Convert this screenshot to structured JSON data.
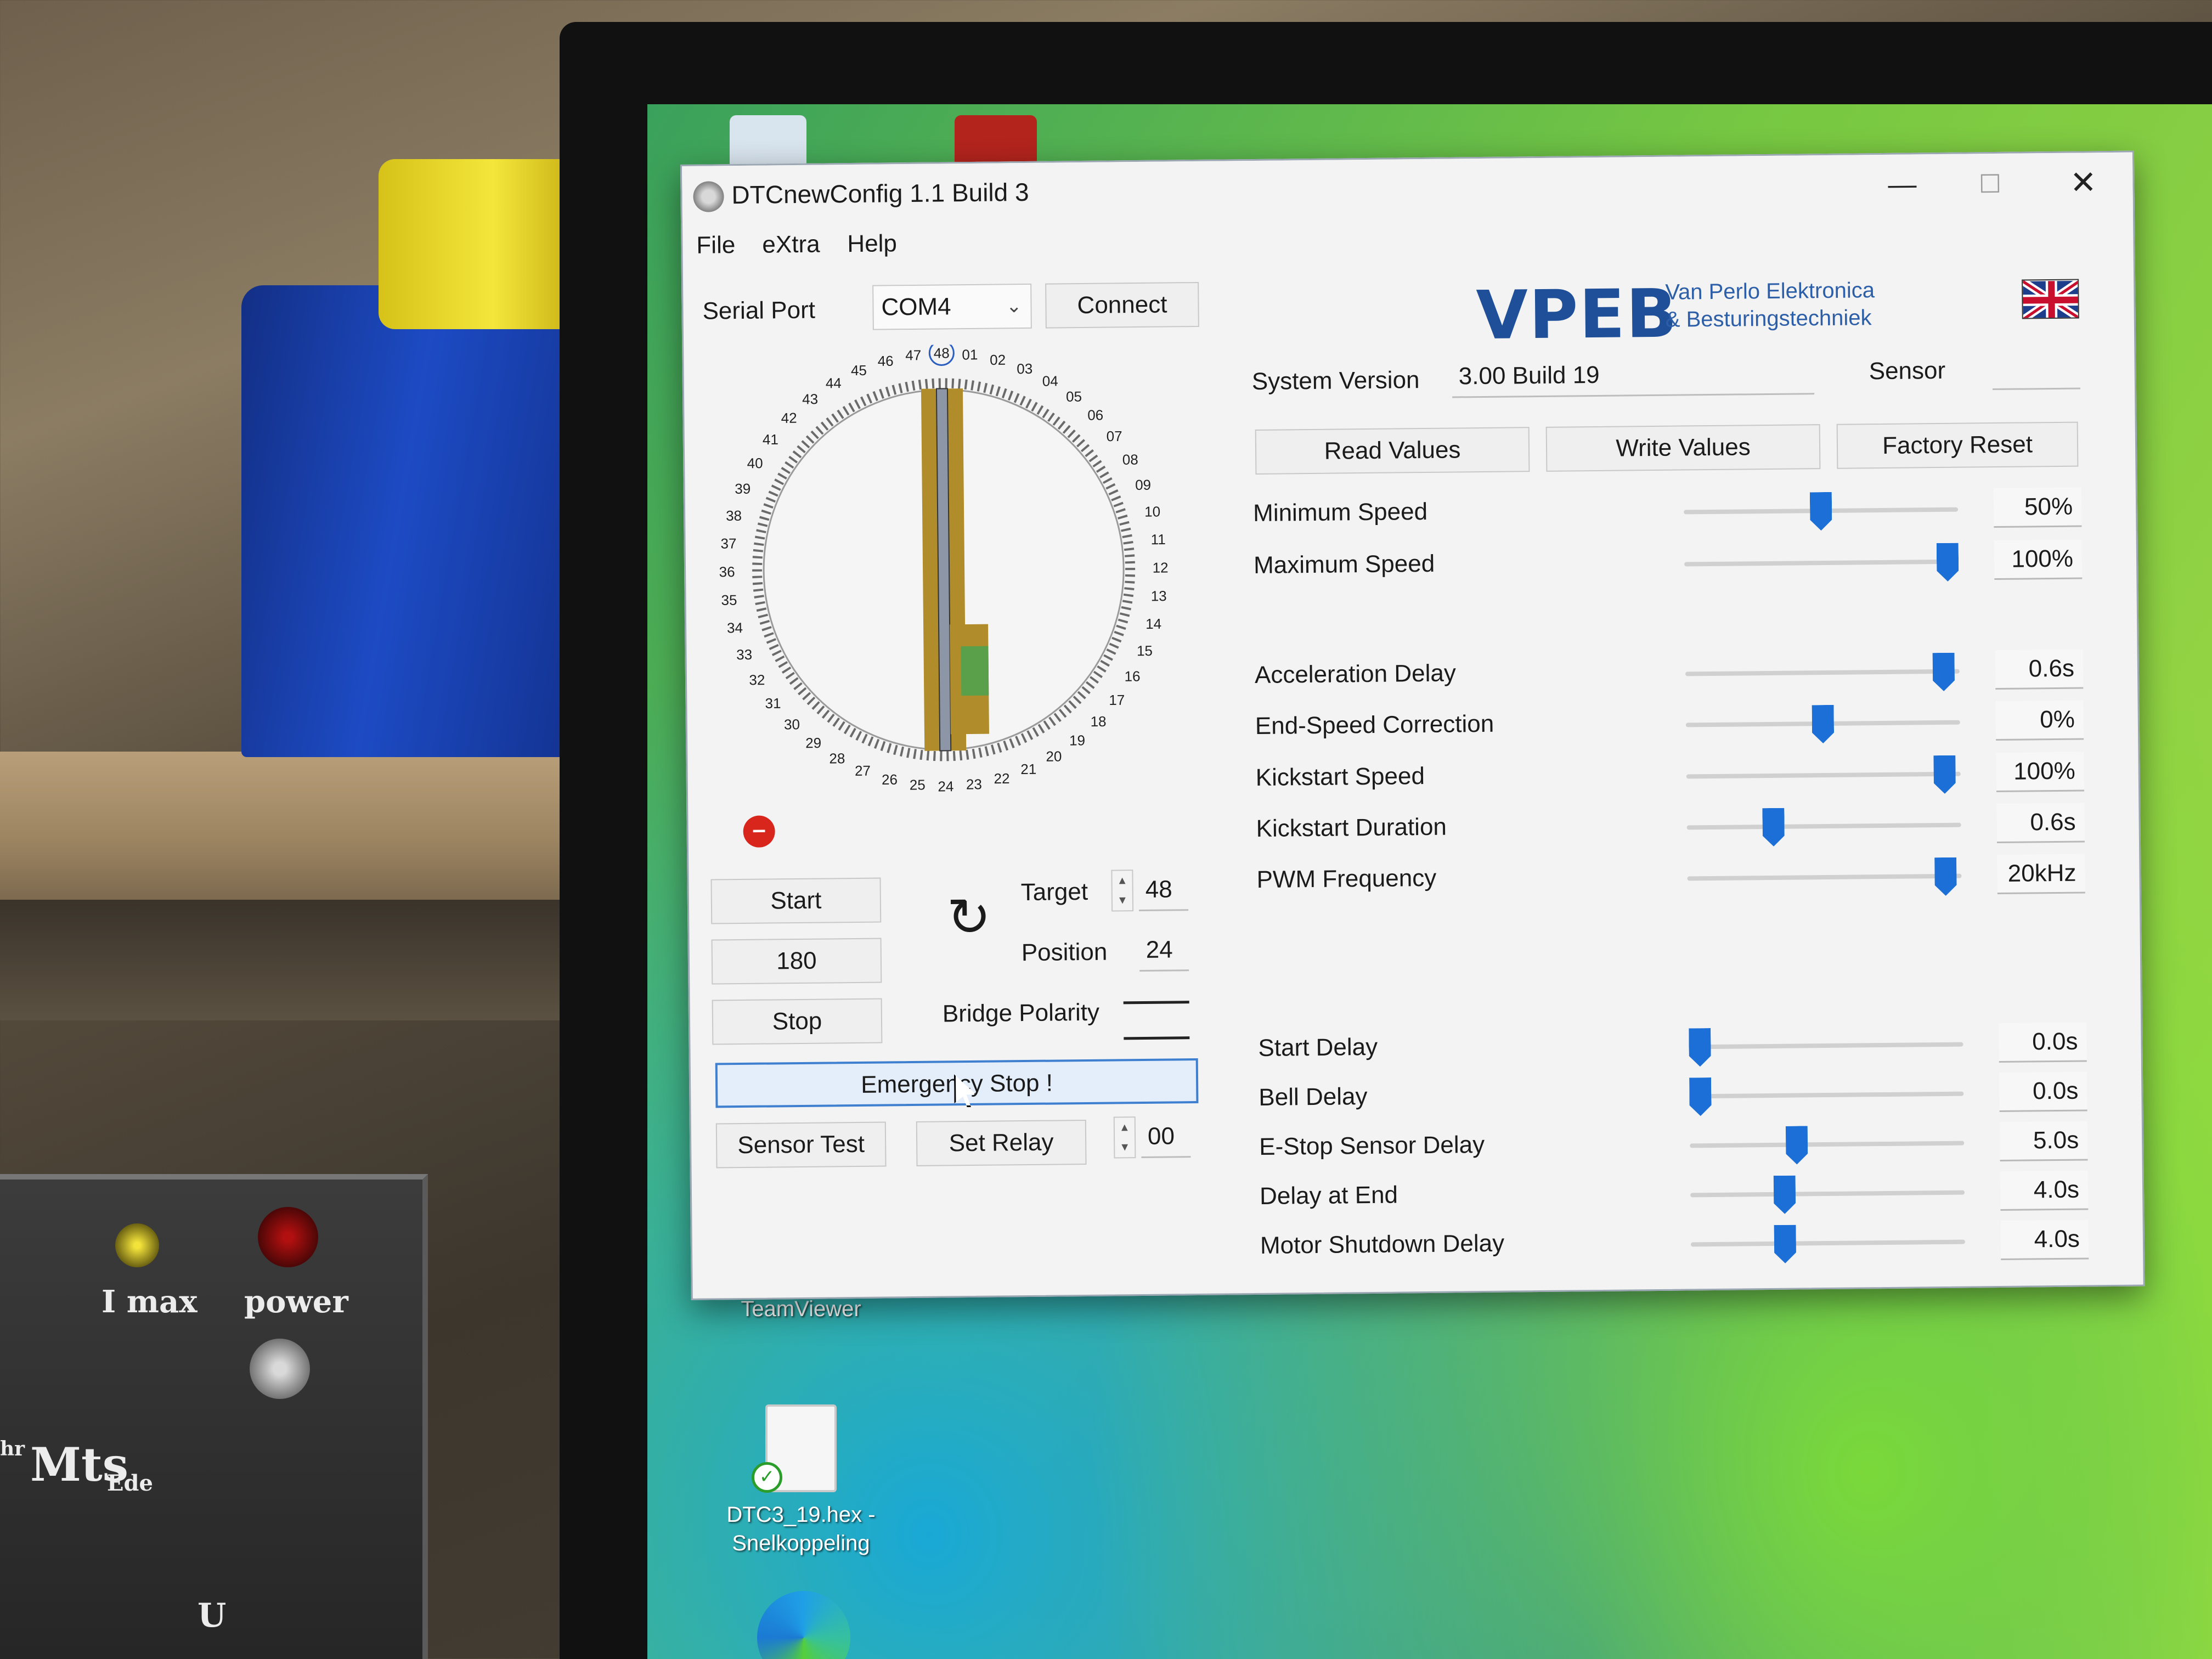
{
  "window": {
    "title": "DTCnewConfig 1.1 Build 3"
  },
  "menu": [
    "File",
    "eXtra",
    "Help"
  ],
  "serial": {
    "label": "Serial Port",
    "port": "COM4",
    "connect_label": "Connect"
  },
  "brand": {
    "logo": "VPEB",
    "line1": "Van Perlo Elektronica",
    "line2": "& Besturingstechniek",
    "flag_icon": "uk-flag-icon"
  },
  "system": {
    "version_label": "System Version",
    "version_value": "3.00 Build 19",
    "sensor_label": "Sensor",
    "sensor_value": ""
  },
  "actions": {
    "read": "Read Values",
    "write": "Write Values",
    "factory": "Factory Reset"
  },
  "turntable": {
    "ticks": [
      "01",
      "02",
      "03",
      "04",
      "05",
      "06",
      "07",
      "08",
      "09",
      "10",
      "11",
      "12",
      "13",
      "14",
      "15",
      "16",
      "17",
      "18",
      "19",
      "20",
      "21",
      "22",
      "23",
      "24",
      "25",
      "26",
      "27",
      "28",
      "29",
      "30",
      "31",
      "32",
      "33",
      "34",
      "35",
      "36",
      "37",
      "38",
      "39",
      "40",
      "41",
      "42",
      "43",
      "44",
      "45",
      "46",
      "47",
      "48"
    ],
    "target_label": "Target",
    "target_value": "48",
    "position_label": "Position",
    "position_value": "24",
    "start_label": "Start",
    "speed_value": "180",
    "stop_label": "Stop",
    "polarity_label": "Bridge Polarity",
    "estop_label": "Emergency Stop !",
    "sensor_test_label": "Sensor Test",
    "set_relay_label": "Set Relay",
    "relay_value": "00"
  },
  "settings": [
    {
      "name": "Minimum Speed",
      "value": "50%",
      "level": 0.5
    },
    {
      "name": "Maximum Speed",
      "value": "100%",
      "level": 1.0
    },
    {
      "name": "Acceleration Delay",
      "value": "0.6s",
      "level": 0.98
    },
    {
      "name": "End-Speed Correction",
      "value": "0%",
      "level": 0.5
    },
    {
      "name": "Kickstart Speed",
      "value": "100%",
      "level": 0.98
    },
    {
      "name": "Kickstart Duration",
      "value": "0.6s",
      "level": 0.3
    },
    {
      "name": "PWM Frequency",
      "value": "20kHz",
      "level": 0.98
    },
    {
      "name": "Start Delay",
      "value": "0.0s",
      "level": 0.0
    },
    {
      "name": "Bell Delay",
      "value": "0.0s",
      "level": 0.0
    },
    {
      "name": "E-Stop Sensor Delay",
      "value": "5.0s",
      "level": 0.38
    },
    {
      "name": "Delay at End",
      "value": "4.0s",
      "level": 0.33
    },
    {
      "name": "Motor Shutdown Delay",
      "value": "4.0s",
      "level": 0.33
    }
  ],
  "desktop": {
    "icon_label1": "DTC3_19.hex -",
    "icon_label2": "Snelkoppeling",
    "teamviewer_label": "TeamViewer"
  },
  "device": {
    "imax_label": "I max",
    "power_label": "power",
    "brand_label": "Mts",
    "sub_label": "Ede",
    "sub_left": "hr",
    "u_label": "U"
  }
}
